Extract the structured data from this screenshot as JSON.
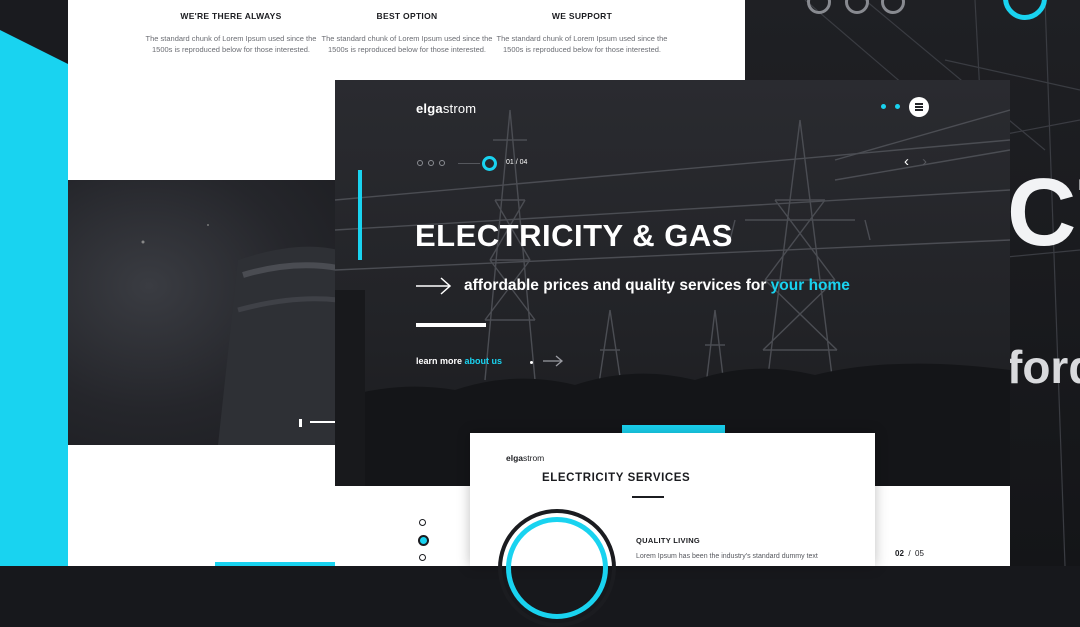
{
  "brand": {
    "name_part1": "elga",
    "name_part2": "strom",
    "accent": "#19d3f0",
    "dark": "#222327"
  },
  "features": [
    {
      "title": "WE'RE THERE ALWAYS",
      "text": "The standard chunk of Lorem Ipsum used since the 1500s is reproduced below for those interested."
    },
    {
      "title": "BEST OPTION",
      "text": "The standard chunk of Lorem Ipsum used since the 1500s is reproduced below for those interested."
    },
    {
      "title": "WE SUPPORT",
      "text": "The standard chunk of Lorem Ipsum used since the 1500s is reproduced below for those interested."
    }
  ],
  "background": {
    "big_letters": "CT",
    "big_word": "ford"
  },
  "hero": {
    "slide_counter": "01 / 04",
    "title": "ELECTRICITY & GAS",
    "subtitle_main": "affordable prices and quality services for ",
    "subtitle_highlight": "your home",
    "learn_more": "learn more ",
    "learn_more_link": "about us",
    "menu_icon": "hamburger-icon",
    "prev_icon": "chevron-left-icon",
    "next_icon": "chevron-right-icon"
  },
  "services": {
    "logo_part1": "elga",
    "logo_part2": "strom",
    "title": "ELECTRICITY SERVICES",
    "item_title": "QUALITY LIVING",
    "item_text": "Lorem Ipsum has been the industry's standard dummy text",
    "page_current": "02",
    "page_sep": "/",
    "page_total": "05"
  }
}
